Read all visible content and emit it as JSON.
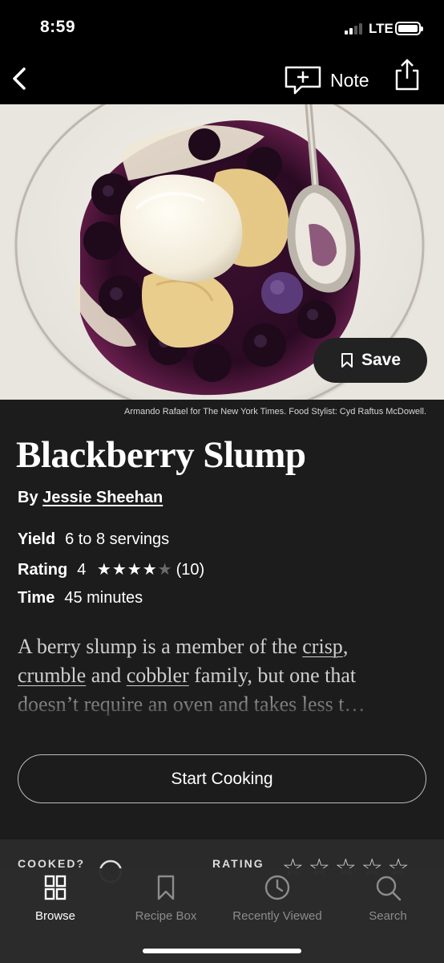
{
  "status_bar": {
    "time": "8:59",
    "network": "LTE",
    "battery_level": 1.0,
    "signal_bars": 2
  },
  "nav": {
    "note_label": "Note",
    "back_icon": "chevron-left-icon",
    "note_icon": "add-note-icon",
    "share_icon": "share-icon"
  },
  "hero": {
    "save_label": "Save",
    "save_icon": "bookmark-icon",
    "photo_credit": "Armando Rafael for The New York Times. Food Stylist: Cyd Raftus McDowell."
  },
  "recipe": {
    "title": "Blackberry Slump",
    "by_prefix": "By",
    "author": "Jessie Sheehan",
    "yield_label": "Yield",
    "yield_value": "6 to 8 servings",
    "rating_label": "Rating",
    "rating_value": "4",
    "rating_stars": 4,
    "rating_max": 5,
    "rating_count": "(10)",
    "time_label": "Time",
    "time_value": "45 minutes",
    "description": {
      "part1": "A berry slump is a member of the ",
      "link1": "crisp",
      "part2": ", ",
      "link2": "crumble",
      "part3": " and ",
      "link3": "cobbler",
      "part4": " family, but one that doesn’t require an oven and takes less t…"
    },
    "start_cooking_label": "Start Cooking"
  },
  "peek_section": {
    "cooked_label": "COOKED?",
    "rating_label": "RATING"
  },
  "tab_bar": {
    "tabs": [
      {
        "label": "Browse",
        "icon": "grid-icon",
        "active": true
      },
      {
        "label": "Recipe Box",
        "icon": "bookmark-icon",
        "active": false
      },
      {
        "label": "Recently Viewed",
        "icon": "clock-icon",
        "active": false
      },
      {
        "label": "Search",
        "icon": "search-icon",
        "active": false
      }
    ]
  },
  "colors": {
    "background": "#1c1c1c",
    "tab_bar": "#2c2c2c",
    "active_tab": "#ffffff",
    "inactive_tab": "#8c8c8c"
  }
}
